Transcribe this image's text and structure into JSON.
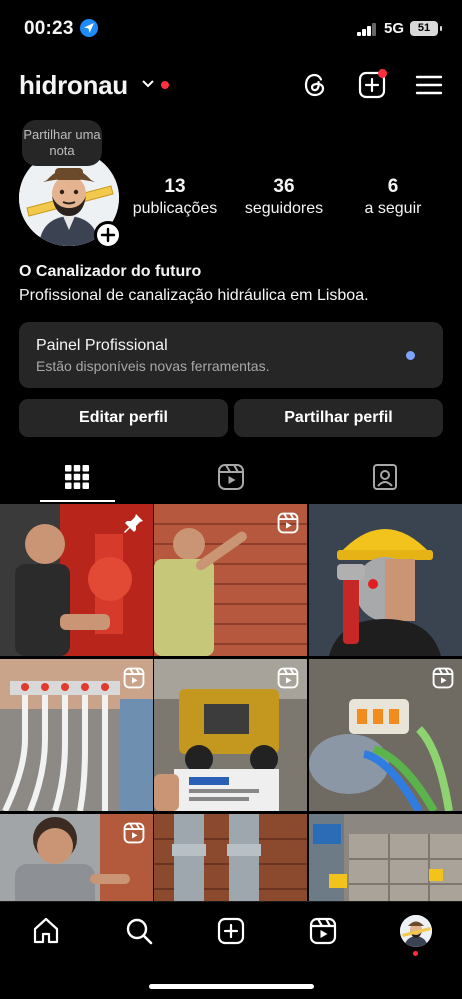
{
  "status_bar": {
    "time": "00:23",
    "network": "5G",
    "battery": "51"
  },
  "header": {
    "username": "hidronau"
  },
  "profile": {
    "note": "Partilhar uma nota",
    "stats": [
      {
        "value": "13",
        "label": "publicações"
      },
      {
        "value": "36",
        "label": "seguidores"
      },
      {
        "value": "6",
        "label": "a seguir"
      }
    ],
    "name": "O Canalizador do futuro",
    "bio": "Profissional de canalização hidráulica em Lisboa."
  },
  "professional_panel": {
    "title": "Painel Profissional",
    "subtitle": "Estão disponíveis novas ferramentas."
  },
  "actions": {
    "edit": "Editar perfil",
    "share": "Partilhar perfil"
  },
  "tabs": [
    "grid-icon",
    "reels-icon",
    "tagged-icon"
  ],
  "grid": [
    {
      "type": "pinned",
      "scene": "red pump station"
    },
    {
      "type": "reel",
      "scene": "brick wall work"
    },
    {
      "type": "image",
      "scene": "cyborg plumber"
    },
    {
      "type": "reel",
      "scene": "manifold pipes"
    },
    {
      "type": "reel",
      "scene": "yellow machine"
    },
    {
      "type": "reel",
      "scene": "wire connectors"
    },
    {
      "type": "reel",
      "scene": "worker at wall"
    },
    {
      "type": "image",
      "scene": "grey pipes"
    },
    {
      "type": "image",
      "scene": "construction site"
    }
  ],
  "colors": {
    "background": "#000000",
    "panel": "#262626",
    "accent_red": "#ff3040",
    "accent_blue": "#7aa4ff"
  }
}
